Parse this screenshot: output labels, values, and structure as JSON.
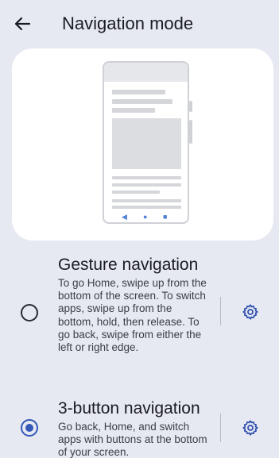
{
  "header": {
    "title": "Navigation mode",
    "back_icon": "arrow-left-icon"
  },
  "illustration": {
    "nav_buttons": [
      "◀",
      "●",
      "■"
    ]
  },
  "options": [
    {
      "title": "Gesture navigation",
      "description": "To go Home, swipe up from the bottom of the screen. To switch apps, swipe up from the bottom, hold, then release. To go back, swipe from either the left or right edge.",
      "selected": false,
      "settings_icon": "gear-icon"
    },
    {
      "title": "3-button navigation",
      "description": "Go back, Home, and switch apps with buttons at the bottom of your screen.",
      "selected": true,
      "settings_icon": "gear-icon"
    }
  ],
  "colors": {
    "background": "#e6e8f2",
    "card": "#ffffff",
    "accent": "#3458b8",
    "nav_dots": "#4f7fd6"
  }
}
